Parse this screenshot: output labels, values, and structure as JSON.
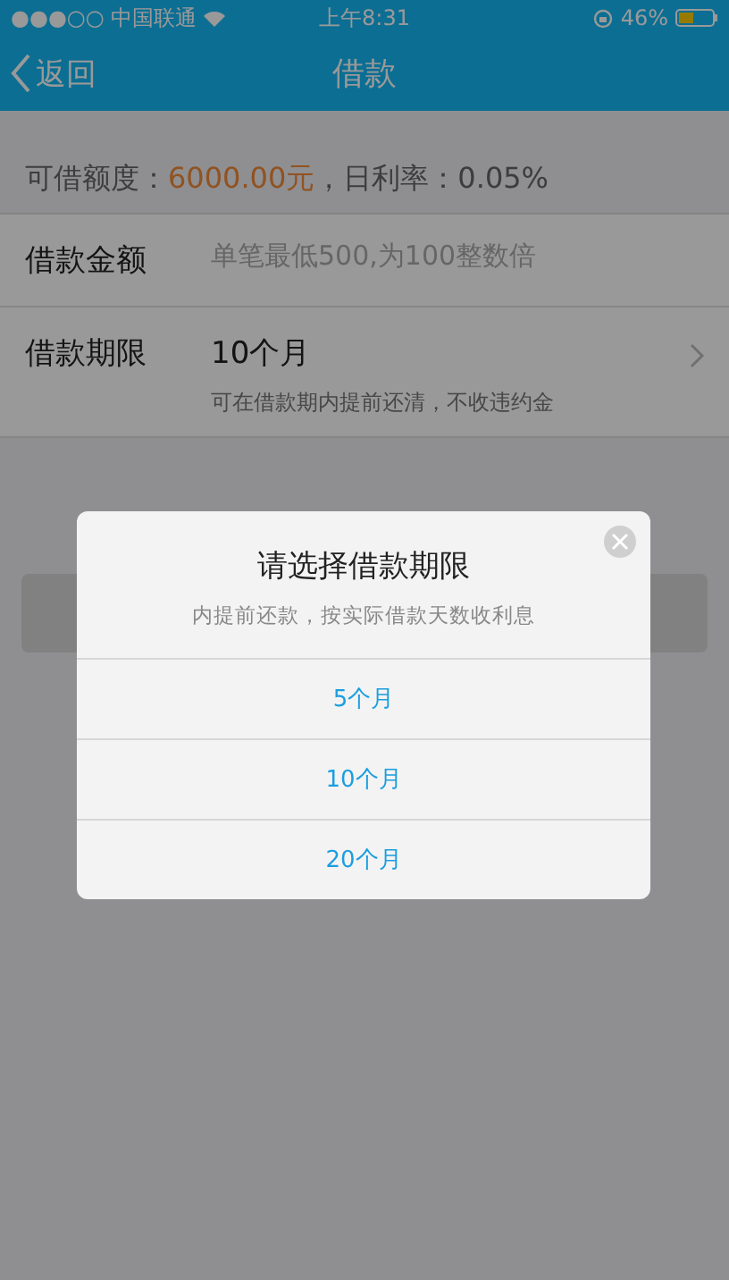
{
  "status_bar": {
    "carrier": "●●●○○ 中国联通",
    "time": "上午8:31",
    "battery": "46%"
  },
  "nav": {
    "back": "返回",
    "title": "借款"
  },
  "quota": {
    "label": "可借额度：",
    "amount": "6000.00元",
    "rate": "，日利率：0.05%"
  },
  "form": [
    {
      "kind": "input",
      "label": "借款金额",
      "placeholder": "单笔最低500,为100整数倍"
    },
    {
      "kind": "select",
      "label": "借款期限",
      "value": "10个月",
      "hint": "可在借款期内提前还清，不收违约金"
    }
  ],
  "dialog": {
    "title": "请选择借款期限",
    "subtitle": "内提前还款，按实际借款天数收利息",
    "options": [
      "5个月",
      "10个月",
      "20个月"
    ]
  }
}
